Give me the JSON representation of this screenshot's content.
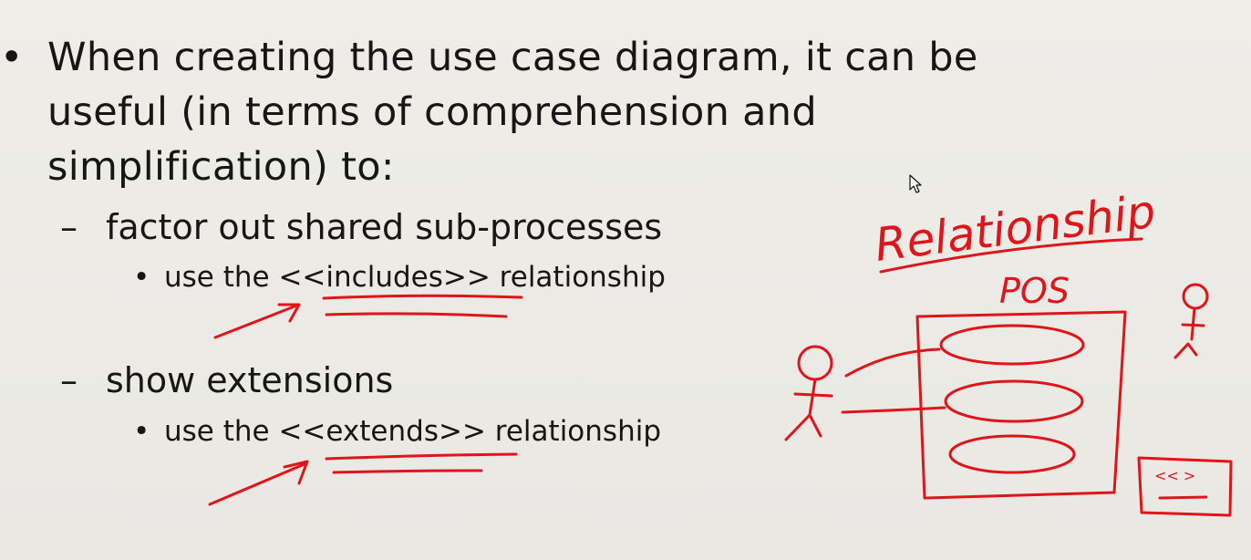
{
  "slide": {
    "main_bullet_lines": [
      "When creating the use case diagram, it can be",
      "useful (in terms of comprehension and",
      "simplification) to:"
    ],
    "subpoints": [
      {
        "dash": "–",
        "text": "factor out shared sub-processes",
        "detail": {
          "bullet": "•",
          "prefix": "use the ",
          "keyword": "<<includes>>",
          "suffix": " relationship"
        }
      },
      {
        "dash": "–",
        "text": "show extensions",
        "detail": {
          "bullet": "•",
          "prefix": "use the ",
          "keyword": "<<extends>>",
          "suffix": " relationship"
        }
      }
    ],
    "main_bullet_glyph": "•"
  },
  "annotations": {
    "heading": "Relationship",
    "system_label": "POS",
    "stereotype_note": "<< >",
    "ink_color": "#e0151b"
  }
}
